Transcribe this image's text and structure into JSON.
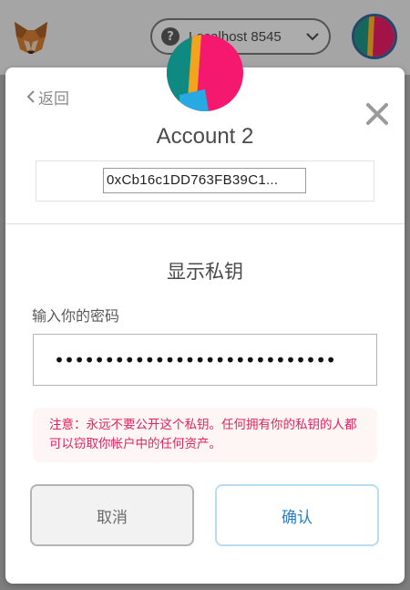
{
  "header": {
    "network_label": "Localhost 8545",
    "help_icon_glyph": "?",
    "logo_icon": "metamask-fox-icon",
    "avatar_icon": "account-identicon"
  },
  "modal": {
    "back_label": "返回",
    "close_icon": "close-icon",
    "account_name": "Account 2",
    "address": "0xCb16c1DD763FB39C1...",
    "section_title": "显示私钥",
    "password_label": "输入你的密码",
    "password_value": "••••••••••••••••••••••••••••",
    "warning_text": "注意：永远不要公开这个私钥。任何拥有你的私钥的人都可以窃取你帐户中的任何资产。",
    "cancel_label": "取消",
    "confirm_label": "确认"
  },
  "colors": {
    "accent_blue": "#2e7ec4",
    "warning_red": "#e0245e",
    "warning_bg": "#fef5f5"
  }
}
